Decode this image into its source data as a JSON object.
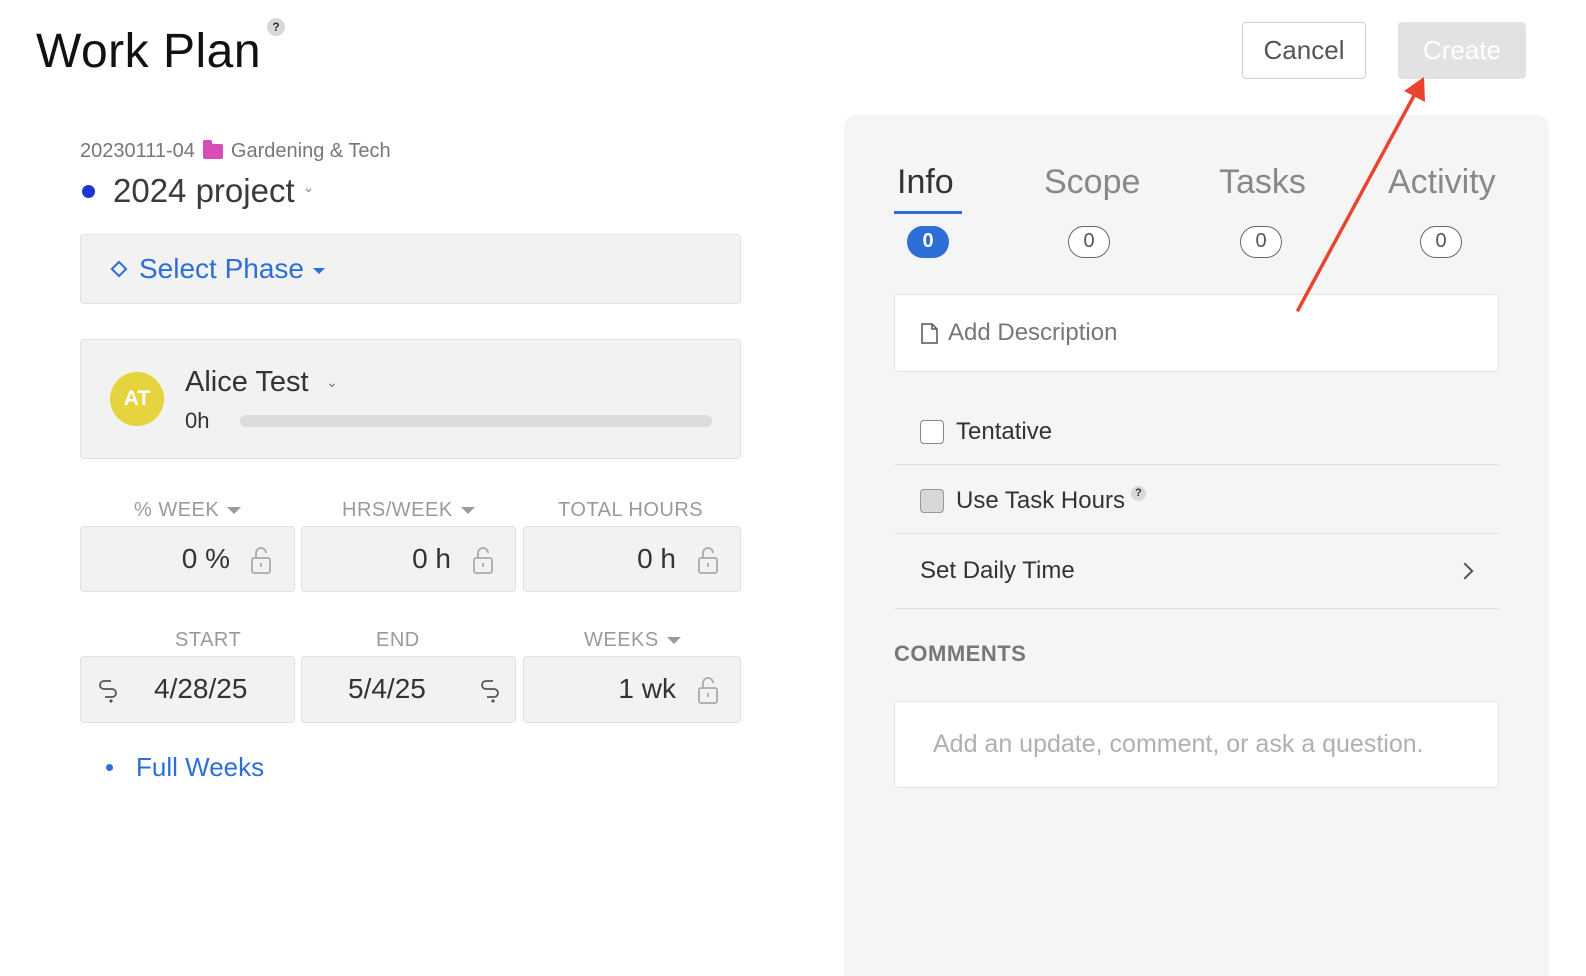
{
  "header": {
    "title": "Work Plan",
    "help": "?",
    "cancel_label": "Cancel",
    "create_label": "Create"
  },
  "project": {
    "code": "20230111-04",
    "folder_icon": "folder-icon",
    "client": "Gardening & Tech",
    "name": "2024 project",
    "dot_color": "#1c36d6"
  },
  "phase": {
    "label": "Select Phase"
  },
  "member": {
    "initials": "AT",
    "name": "Alice Test",
    "hours": "0h",
    "progress": 0,
    "avatar_color": "#e5d43e"
  },
  "allocation": {
    "labels": {
      "percent_week": "% WEEK",
      "hrs_week": "HRS/WEEK",
      "total_hours": "TOTAL HOURS"
    },
    "percent_week_value": "0 %",
    "hrs_week_value": "0 h",
    "total_hours_value": "0 h"
  },
  "dates": {
    "labels": {
      "start": "START",
      "end": "END",
      "weeks": "WEEKS"
    },
    "start_value": "4/28/25",
    "end_value": "5/4/25",
    "weeks_value": "1 wk"
  },
  "full_weeks_label": "Full Weeks",
  "panel": {
    "tabs": [
      {
        "label": "Info",
        "count": "0",
        "active": true
      },
      {
        "label": "Scope",
        "count": "0",
        "active": false
      },
      {
        "label": "Tasks",
        "count": "0",
        "active": false
      },
      {
        "label": "Activity",
        "count": "0",
        "active": false
      }
    ],
    "add_description": "Add Description",
    "tentative_label": "Tentative",
    "use_task_hours_label": "Use Task Hours",
    "help": "?",
    "set_daily_time_label": "Set Daily Time",
    "comments_heading": "COMMENTS",
    "comment_placeholder": "Add an update, comment, or ask a question."
  },
  "colors": {
    "accent": "#2d6fd6",
    "annotation": "#e8452f"
  }
}
